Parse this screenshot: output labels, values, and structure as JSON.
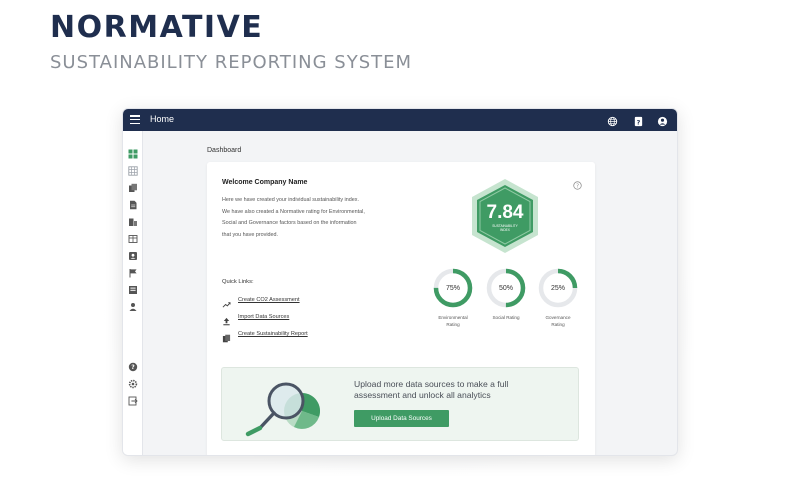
{
  "brand": {
    "title": "NORMATIVE",
    "subtitle": "SUSTAINABILITY REPORTING SYSTEM"
  },
  "topbar": {
    "home_label": "Home"
  },
  "sidebar": {
    "items": [
      "dashboard-icon",
      "grid-icon",
      "copy-icon",
      "document-icon",
      "buildings-icon",
      "table-icon",
      "contact-icon",
      "flag-icon",
      "report-icon",
      "upload-user-icon"
    ],
    "bottom_items": [
      "help-icon",
      "gear-icon",
      "logout-icon"
    ]
  },
  "main": {
    "page_title": "Dashboard",
    "welcome": "Welcome Company Name",
    "intro_lines": [
      "Here we have created your individual sustainability index.",
      "We have also created a Normative rating for Environmental,",
      "Social and Governance factors based on the information",
      "that you have provided."
    ],
    "index": {
      "value": "7.84",
      "label_line1": "SUSTAINABILITY",
      "label_line2": "INDEX"
    },
    "ratings": [
      {
        "value": "75%",
        "fraction": 0.75,
        "label_line1": "Environmental",
        "label_line2": "Rating"
      },
      {
        "value": "50%",
        "fraction": 0.5,
        "label_line1": "Social Rating",
        "label_line2": ""
      },
      {
        "value": "25%",
        "fraction": 0.25,
        "label_line1": "Governance",
        "label_line2": "Rating"
      }
    ],
    "quick_links": {
      "title": "Quick Links:",
      "items": [
        "Create CO2 Assessment",
        "Import Data Sources",
        "Create Sustainability Report"
      ]
    },
    "banner": {
      "line1": "Upload more data sources to make a full",
      "line2": "assessment and unlock all analytics",
      "button_label": "Upload Data Sources"
    }
  },
  "colors": {
    "navy": "#1f2e4e",
    "green": "#3f9b64",
    "ring_track": "#e6e8eb"
  }
}
